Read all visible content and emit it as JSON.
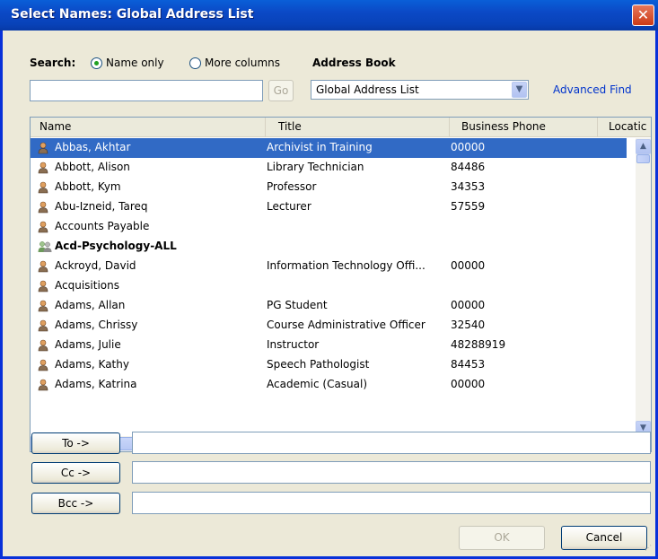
{
  "window": {
    "title": "Select Names: Global Address List",
    "close_glyph": "✕"
  },
  "search": {
    "label": "Search:",
    "opt_name_only": "Name only",
    "opt_more_columns": "More columns",
    "selected": "Name only",
    "input_value": "",
    "go_label": "Go"
  },
  "address_book": {
    "label": "Address Book",
    "value": "Global Address List",
    "advanced_find": "Advanced Find"
  },
  "columns": [
    "Name",
    "Title",
    "Business Phone",
    "Locatic"
  ],
  "rows": [
    {
      "name": "Abbas, Akhtar",
      "title": "Archivist in Training",
      "phone": "00000",
      "icon": "contact-icon",
      "bold": false,
      "selected": true
    },
    {
      "name": "Abbott, Alison",
      "title": "Library Technician",
      "phone": "84486",
      "icon": "contact-icon",
      "bold": false,
      "selected": false
    },
    {
      "name": "Abbott, Kym",
      "title": "Professor",
      "phone": "34353",
      "icon": "contact-icon",
      "bold": false,
      "selected": false
    },
    {
      "name": "Abu-Izneid, Tareq",
      "title": "Lecturer",
      "phone": "57559",
      "icon": "contact-icon",
      "bold": false,
      "selected": false
    },
    {
      "name": "Accounts Payable",
      "title": "",
      "phone": "",
      "icon": "contact-icon",
      "bold": false,
      "selected": false
    },
    {
      "name": "Acd-Psychology-ALL",
      "title": "",
      "phone": "",
      "icon": "group-icon",
      "bold": true,
      "selected": false
    },
    {
      "name": "Ackroyd, David",
      "title": "Information Technology Offi...",
      "phone": "00000",
      "icon": "contact-icon",
      "bold": false,
      "selected": false
    },
    {
      "name": "Acquisitions",
      "title": "",
      "phone": "",
      "icon": "contact-icon",
      "bold": false,
      "selected": false
    },
    {
      "name": "Adams, Allan",
      "title": "PG Student",
      "phone": "00000",
      "icon": "contact-icon",
      "bold": false,
      "selected": false
    },
    {
      "name": "Adams, Chrissy",
      "title": "Course Administrative Officer",
      "phone": "32540",
      "icon": "contact-icon",
      "bold": false,
      "selected": false
    },
    {
      "name": "Adams, Julie",
      "title": "Instructor",
      "phone": "48288919",
      "icon": "contact-icon",
      "bold": false,
      "selected": false
    },
    {
      "name": "Adams, Kathy",
      "title": "Speech Pathologist",
      "phone": "84453",
      "icon": "contact-icon",
      "bold": false,
      "selected": false
    },
    {
      "name": "Adams, Katrina",
      "title": "Academic (Casual)",
      "phone": "00000",
      "icon": "contact-icon",
      "bold": false,
      "selected": false
    }
  ],
  "recipients": {
    "to_label": "To ->",
    "to_value": "",
    "cc_label": "Cc ->",
    "cc_value": "",
    "bcc_label": "Bcc ->",
    "bcc_value": ""
  },
  "footer": {
    "ok_label": "OK",
    "cancel_label": "Cancel"
  },
  "colors": {
    "title_bar": "#0b49c6",
    "selection": "#316ac5",
    "close_button": "#cc3a16",
    "link": "#0033cc"
  }
}
